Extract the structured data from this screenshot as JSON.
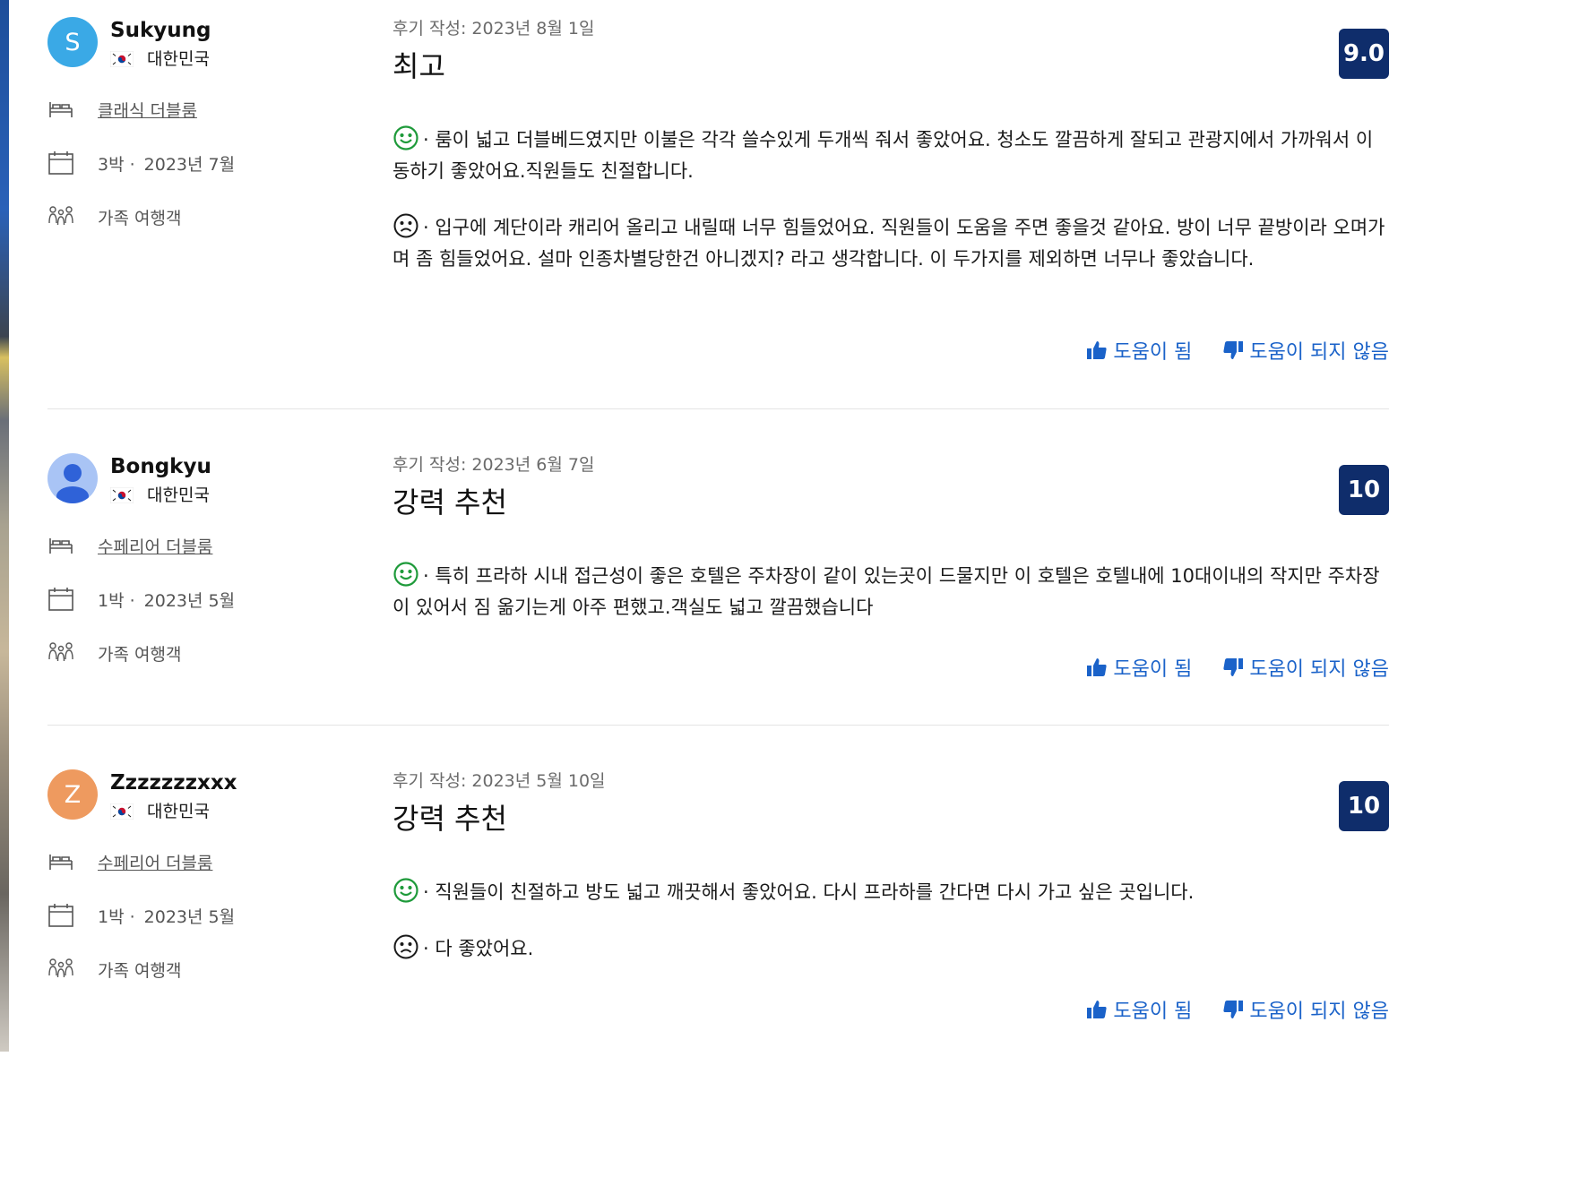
{
  "labels": {
    "helpful": "도움이 됨",
    "not_helpful": "도움이 되지 않음"
  },
  "colors": {
    "score_badge": "#0f2d6b",
    "vote_link": "#1a62c9",
    "positive_face": "#1e9a3a",
    "negative_face": "#1a1a1a"
  },
  "reviews": [
    {
      "reviewer_name": "Sukyung",
      "avatar_initial": "S",
      "avatar_color": "#3aa9e6",
      "country": "대한민국",
      "room": "클래식 더블룸",
      "nights": "3박 ·",
      "stay_month": "2023년 7월",
      "traveler_type": "가족 여행객",
      "date": "후기 작성: 2023년 8월 1일",
      "title": "최고",
      "score": "9.0",
      "positive": "· 룸이 넓고 더블베드였지만 이불은 각각 쓸수있게 두개씩 줘서 좋았어요. 청소도 깔끔하게 잘되고 관광지에서 가까워서 이동하기 좋았어요.직원들도 친절합니다.",
      "negative": "· 입구에 계단이라 캐리어 올리고 내릴때 너무 힘들었어요. 직원들이 도움을 주면 좋을것 같아요. 방이 너무 끝방이라 오며가며 좀 힘들었어요. 설마 인종차별당한건 아니겠지? 라고 생각합니다. 이 두가지를 제외하면 너무나 좋았습니다."
    },
    {
      "reviewer_name": "Bongkyu",
      "avatar_initial": "",
      "avatar_color": "#a9c4f5",
      "country": "대한민국",
      "room": "수페리어 더블룸",
      "nights": "1박 ·",
      "stay_month": "2023년 5월",
      "traveler_type": "가족 여행객",
      "date": "후기 작성: 2023년 6월 7일",
      "title": "강력 추천",
      "score": "10",
      "positive": "· 특히 프라하 시내 접근성이 좋은 호텔은 주차장이 같이 있는곳이 드물지만 이 호텔은 호텔내에 10대이내의 작지만 주차장이 있어서 짐 옮기는게 아주 편했고.객실도 넓고 깔끔했습니다",
      "negative": ""
    },
    {
      "reviewer_name": "Zzzzzzzxxx",
      "avatar_initial": "Z",
      "avatar_color": "#ee9a5f",
      "country": "대한민국",
      "room": "수페리어 더블룸",
      "nights": "1박 ·",
      "stay_month": "2023년 5월",
      "traveler_type": "가족 여행객",
      "date": "후기 작성: 2023년 5월 10일",
      "title": "강력 추천",
      "score": "10",
      "positive": "· 직원들이 친절하고 방도 넓고 깨끗해서 좋았어요. 다시 프라하를 간다면 다시 가고 싶은 곳입니다.",
      "negative": "· 다 좋았어요."
    }
  ]
}
